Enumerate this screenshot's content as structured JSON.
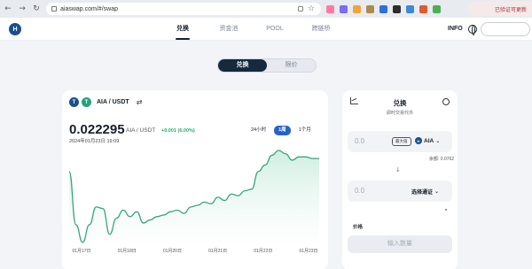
{
  "browser": {
    "url": "aiaswap.com/#/swap",
    "profile_label": "已验证可更新"
  },
  "header": {
    "logo_text": "H",
    "nav": [
      {
        "label": "兑换",
        "active": true
      },
      {
        "label": "资金池",
        "active": false
      },
      {
        "label": "POOL",
        "active": false
      },
      {
        "label": "跨链桥",
        "active": false
      }
    ],
    "info_label": "INFO"
  },
  "switch": {
    "options": [
      {
        "label": "兑换",
        "active": true
      },
      {
        "label": "限价",
        "active": false
      }
    ]
  },
  "chart_panel": {
    "token_a_icon": "T",
    "token_b_icon": "T",
    "pair_name": "AIA / USDT",
    "swap_icon": "⇄",
    "price": "0.022295",
    "price_pair": "AIA / USDT",
    "price_change": "+0.001 (6.00%)",
    "timestamp": "2024年01月23日 19:09",
    "periods": [
      {
        "label": "24小时",
        "active": false
      },
      {
        "label": "1周",
        "active": true
      },
      {
        "label": "1个月",
        "active": false
      }
    ],
    "x_ticks": [
      "01月17日",
      "01月18日",
      "01月20日",
      "01月21日",
      "01月22日",
      "01月23日"
    ]
  },
  "chart_data": {
    "type": "area",
    "title": "",
    "xlabel": "",
    "ylabel": "",
    "x": [
      "01月17日",
      "01月18日",
      "01月20日",
      "01月21日",
      "01月22日",
      "01月23日"
    ],
    "values": [
      0.0215,
      0.0182,
      0.0171,
      0.0182,
      0.0193,
      0.0192,
      0.0176,
      0.0186,
      0.0191,
      0.0187,
      0.019,
      0.0183,
      0.0185,
      0.0187,
      0.0188,
      0.019,
      0.0191,
      0.0189,
      0.0193,
      0.0194,
      0.0196,
      0.0195,
      0.0199,
      0.0197,
      0.0201,
      0.02,
      0.0203,
      0.0204,
      0.0215,
      0.0219,
      0.0225,
      0.0228,
      0.0226,
      0.0222,
      0.0224,
      0.0224,
      0.0223,
      0.0223
    ],
    "color": "#3aa57a",
    "fill_color": "#cfeee1",
    "grid": false
  },
  "swap_panel": {
    "title": "兑换",
    "subtitle": "即时交易代币",
    "from_amount": "0.0",
    "max_label": "最大值",
    "from_token": "AIA",
    "balance": "余额: 0.0762",
    "arrow": "↓",
    "to_amount": "0.0",
    "select_token_label": "选择通证",
    "route_label": "价格",
    "submit_label": "输入数量"
  },
  "colors": {
    "accent": "#2563c9",
    "dark": "#16293d",
    "positive": "#27b06b"
  }
}
